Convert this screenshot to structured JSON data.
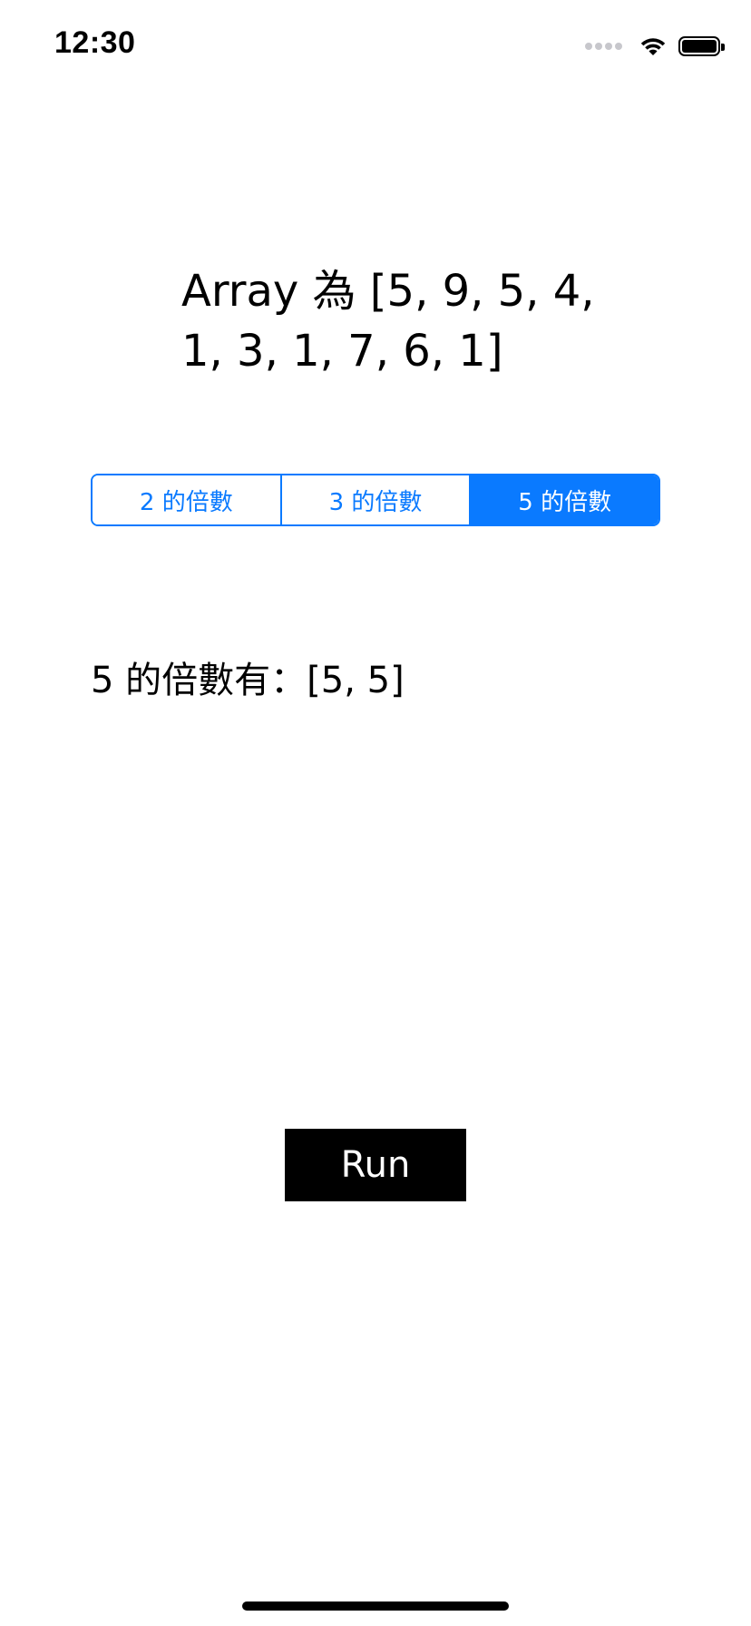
{
  "status_bar": {
    "time": "12:30",
    "icons": [
      "signal-dots-icon",
      "wifi-icon",
      "battery-icon"
    ]
  },
  "main": {
    "array_title": "Array 為 [5, 9, 5, 4,\n1, 3, 1, 7, 6, 1]",
    "segments": [
      {
        "label": "2 的倍數",
        "selected": false
      },
      {
        "label": "3 的倍數",
        "selected": false
      },
      {
        "label": "5 的倍數",
        "selected": true
      }
    ],
    "result_text": "5 的倍數有：[5, 5]",
    "run_label": "Run"
  },
  "colors": {
    "accent": "#0a7aff",
    "button_bg": "#000000",
    "button_text": "#ffffff",
    "background": "#ffffff"
  }
}
